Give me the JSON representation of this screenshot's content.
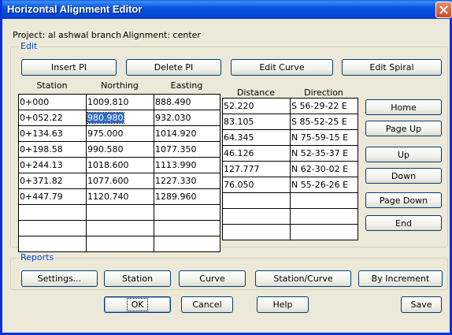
{
  "window": {
    "title": "Horizontal Alignment Editor"
  },
  "info": {
    "project": "Project: al ashwal branch",
    "alignment": "Alignment: center"
  },
  "edit": {
    "group_label": "Edit",
    "buttons": [
      "Insert PI",
      "Delete PI",
      "Edit Curve",
      "Edit Spiral"
    ]
  },
  "grid1": {
    "headers": [
      "Station",
      "Northing",
      "Easting"
    ],
    "rows": [
      [
        "0+000",
        "1009.810",
        "888.490"
      ],
      [
        "0+052.22",
        "980.980",
        "932.030"
      ],
      [
        "0+134.63",
        "975.000",
        "1014.920"
      ],
      [
        "0+198.58",
        "990.580",
        "1077.350"
      ],
      [
        "0+244.13",
        "1018.600",
        "1113.990"
      ],
      [
        "0+371.82",
        "1077.600",
        "1227.330"
      ],
      [
        "0+447.79",
        "1120.740",
        "1289.960"
      ],
      [
        "",
        "",
        ""
      ],
      [
        "",
        "",
        ""
      ],
      [
        "",
        "",
        ""
      ]
    ]
  },
  "grid2": {
    "headers": [
      "Distance",
      "Direction"
    ],
    "rows": [
      [
        "52.220",
        "S 56-29-22 E"
      ],
      [
        "83.105",
        "S 85-52-25 E"
      ],
      [
        "64.345",
        "N 75-59-15 E"
      ],
      [
        "46.126",
        "N 52-35-37 E"
      ],
      [
        "127.777",
        "N 62-30-02 E"
      ],
      [
        "76.050",
        "N 55-26-26 E"
      ],
      [
        "",
        ""
      ],
      [
        "",
        ""
      ],
      [
        "",
        ""
      ]
    ]
  },
  "nav": {
    "buttons": [
      "Home",
      "Page Up",
      "Up",
      "Down",
      "Page Down",
      "End"
    ]
  },
  "reports": {
    "group_label": "Reports",
    "buttons": [
      "Settings...",
      "Station",
      "Curve",
      "Station/Curve",
      "By Increment"
    ]
  },
  "footer": {
    "ok": "OK",
    "cancel": "Cancel",
    "help": "Help",
    "save": "Save"
  }
}
